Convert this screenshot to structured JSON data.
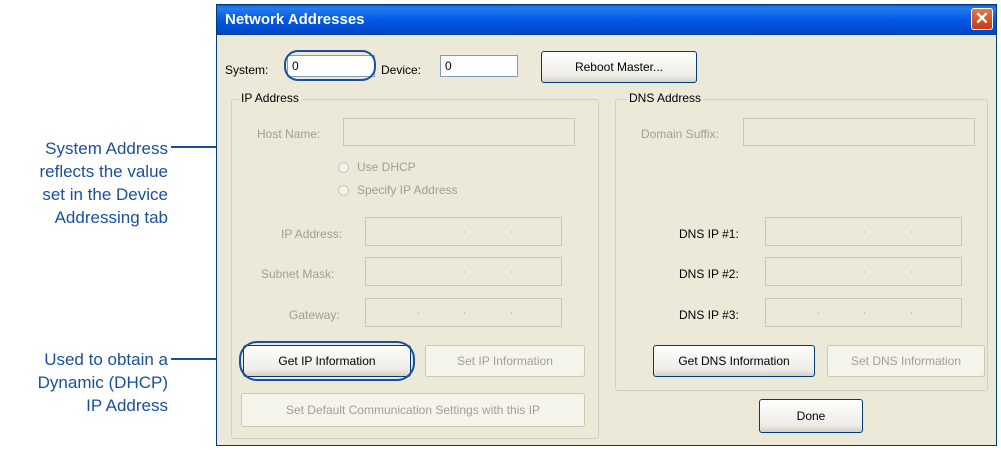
{
  "annotations": {
    "system_address_lines": [
      "System Address",
      "reflects the value",
      "set in the Device",
      "Addressing tab"
    ],
    "dhcp_lines": [
      "Used to obtain a",
      "Dynamic (DHCP)",
      "IP Address"
    ]
  },
  "dialog": {
    "title": "Network Addresses",
    "close_glyph": "✕",
    "system_label": "System:",
    "system_value": "0",
    "device_label": "Device:",
    "device_value": "0",
    "reboot_button": "Reboot Master...",
    "ip_group": {
      "title": "IP Address",
      "host_name_label": "Host Name:",
      "use_dhcp": "Use DHCP",
      "specify_ip": "Specify IP Address",
      "ip_address_label": "IP Address:",
      "subnet_mask_label": "Subnet Mask:",
      "gateway_label": "Gateway:",
      "get_ip_button": "Get IP Information",
      "set_ip_button": "Set IP Information",
      "set_default_button": "Set Default Communication Settings with this IP"
    },
    "dns_group": {
      "title": "DNS Address",
      "domain_suffix_label": "Domain Suffix:",
      "dns1_label": "DNS IP #1:",
      "dns2_label": "DNS IP #2:",
      "dns3_label": "DNS IP #3:",
      "get_dns_button": "Get DNS Information",
      "set_dns_button": "Set DNS Information"
    },
    "done_button": "Done"
  },
  "colors": {
    "annotation": "#1a4f9c",
    "titlebar": "#0058e6",
    "dialog_bg": "#ece9d8"
  }
}
